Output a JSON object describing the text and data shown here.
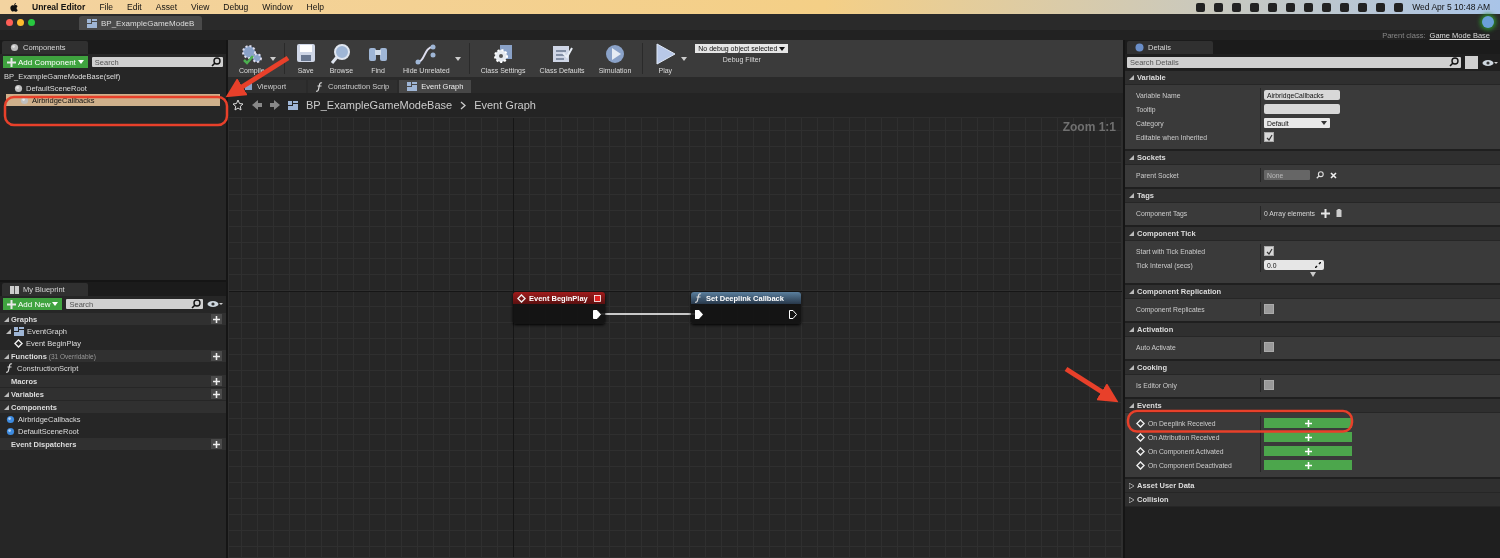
{
  "menubar": {
    "app": "Unreal Editor",
    "menus": [
      "File",
      "Edit",
      "Asset",
      "View",
      "Debug",
      "Window",
      "Help"
    ],
    "clock": "Wed Apr 5  10:48 AM"
  },
  "document_tab": {
    "title": "BP_ExampleGameModeB"
  },
  "parent_class": {
    "label": "Parent class:",
    "value": "Game Mode Base"
  },
  "components_panel": {
    "tab": "Components",
    "add_button": "Add Component",
    "search_placeholder": "Search",
    "items": [
      {
        "label": "BP_ExampleGameModeBase(self)",
        "selected": false,
        "children": [
          {
            "label": "DefaultSceneRoot",
            "kind": "scene",
            "selected": false
          },
          {
            "label": "AirbridgeCallbacks",
            "kind": "scene",
            "selected": true
          }
        ]
      }
    ]
  },
  "toolbar": [
    {
      "label": "Compile",
      "kind": "compile",
      "dropdown": true
    },
    {
      "label": "Save",
      "kind": "save",
      "dropdown": false
    },
    {
      "label": "Browse",
      "kind": "browse",
      "dropdown": false
    },
    {
      "label": "Find",
      "kind": "find",
      "dropdown": false
    },
    {
      "label": "Hide Unrelated",
      "kind": "hide",
      "dropdown": true
    },
    {
      "label": "Class Settings",
      "kind": "settings",
      "dropdown": false
    },
    {
      "label": "Class Defaults",
      "kind": "defaults",
      "dropdown": false
    },
    {
      "label": "Simulation",
      "kind": "simulation",
      "dropdown": false
    },
    {
      "label": "Play",
      "kind": "play",
      "dropdown": true
    }
  ],
  "debug_filter": {
    "value": "No debug object selected",
    "label": "Debug Filter"
  },
  "graph_tabs": [
    {
      "label": "Viewport",
      "kind": "viewport",
      "selected": false
    },
    {
      "label": "Construction Scrip",
      "kind": "function",
      "selected": false
    },
    {
      "label": "Event Graph",
      "kind": "graph",
      "selected": true
    }
  ],
  "breadcrumb": {
    "blueprint": "BP_ExampleGameModeBase",
    "graph": "Event Graph"
  },
  "zoom": "Zoom 1:1",
  "nodes": [
    {
      "title": "Event BeginPlay",
      "kind": "event"
    },
    {
      "title": "Set Deeplink Callback",
      "kind": "function"
    }
  ],
  "my_blueprint": {
    "tab": "My Blueprint",
    "add_button": "Add New",
    "search_placeholder": "Search",
    "sections": [
      {
        "title": "Graphs",
        "expandable": true,
        "addable": true,
        "items": [
          {
            "label": "EventGraph",
            "kind": "graph",
            "children": [
              {
                "label": "Event BeginPlay",
                "kind": "event"
              }
            ]
          }
        ]
      },
      {
        "title": "Functions",
        "note": "(31 Overridable)",
        "expandable": true,
        "addable": true,
        "items": [
          {
            "label": "ConstructionScript",
            "kind": "function"
          }
        ]
      },
      {
        "title": "Macros",
        "expandable": false,
        "addable": true
      },
      {
        "title": "Variables",
        "expandable": true,
        "addable": true
      },
      {
        "title": "Components",
        "expandable": true,
        "addable": false,
        "items": [
          {
            "label": "AirbridgeCallbacks",
            "kind": "component"
          },
          {
            "label": "DefaultSceneRoot",
            "kind": "component"
          }
        ]
      },
      {
        "title": "Event Dispatchers",
        "expandable": false,
        "addable": true
      }
    ]
  },
  "details": {
    "tab": "Details",
    "search_placeholder": "Search Details",
    "sections": [
      {
        "title": "Variable",
        "expanded": true,
        "rows": [
          {
            "label": "Variable Name",
            "kind": "text",
            "value": "AirbridgeCallbacks"
          },
          {
            "label": "Tooltip",
            "kind": "text"
          },
          {
            "label": "Category",
            "kind": "dropdown",
            "value": "Default"
          },
          {
            "label": "Editable when Inherited",
            "kind": "checkbox",
            "checked": true
          }
        ]
      },
      {
        "title": "Sockets",
        "expanded": true,
        "rows": [
          {
            "label": "Parent Socket",
            "kind": "socket",
            "value": "None"
          }
        ]
      },
      {
        "title": "Tags",
        "expanded": true,
        "rows": [
          {
            "label": "Component Tags",
            "kind": "array",
            "value": "0 Array elements"
          }
        ]
      },
      {
        "title": "Component Tick",
        "expanded": true,
        "advanced": true,
        "rows": [
          {
            "label": "Start with Tick Enabled",
            "kind": "checkbox",
            "checked": true
          },
          {
            "label": "Tick Interval (secs)",
            "kind": "number",
            "value": "0.0"
          }
        ]
      },
      {
        "title": "Component Replication",
        "expanded": true,
        "rows": [
          {
            "label": "Component Replicates",
            "kind": "checkbox",
            "checked": false
          }
        ]
      },
      {
        "title": "Activation",
        "expanded": true,
        "rows": [
          {
            "label": "Auto Activate",
            "kind": "checkbox",
            "checked": false
          }
        ]
      },
      {
        "title": "Cooking",
        "expanded": true,
        "rows": [
          {
            "label": "Is Editor Only",
            "kind": "checkbox",
            "checked": false
          }
        ]
      },
      {
        "title": "Events",
        "expanded": true,
        "rows": [
          {
            "label": "On Deeplink Received",
            "kind": "event"
          },
          {
            "label": "On Attribution Received",
            "kind": "event"
          },
          {
            "label": "On Component Activated",
            "kind": "event"
          },
          {
            "label": "On Component Deactivated",
            "kind": "event"
          }
        ]
      },
      {
        "title": "Asset User Data",
        "expanded": false
      },
      {
        "title": "Collision",
        "expanded": false
      }
    ]
  }
}
